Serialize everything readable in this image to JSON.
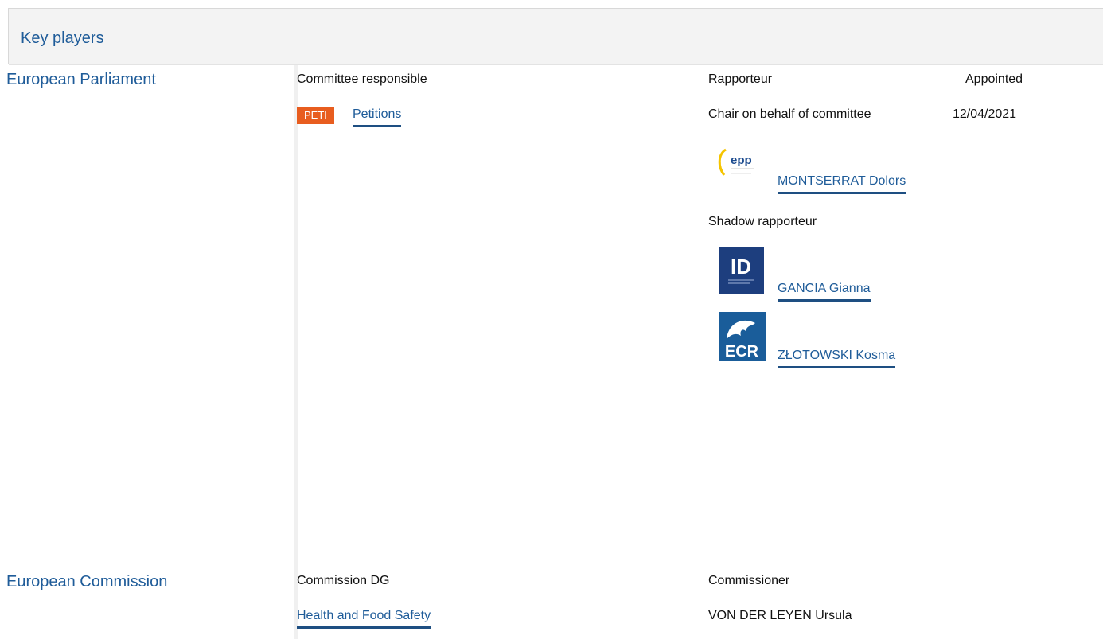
{
  "section": {
    "title": "Key players"
  },
  "parliament": {
    "institution": "European Parliament",
    "committee_label": "Committee responsible",
    "committee_tag": "PETI",
    "committee_name": "Petitions",
    "rapporteur_label": "Rapporteur",
    "appointed_label": "Appointed",
    "chair_label": "Chair on behalf of committee",
    "appointed_date": "12/04/2021",
    "rapporteur": {
      "group_logo": "epp-logo",
      "group_logo_text": "epp",
      "name": "MONTSERRAT Dolors"
    },
    "shadow_label": "Shadow rapporteur",
    "shadows": [
      {
        "group_logo": "id-logo",
        "group_logo_text": "ID",
        "name": "GANCIA Gianna"
      },
      {
        "group_logo": "ecr-logo",
        "group_logo_text": "ECR",
        "name": "ZŁOTOWSKI Kosma"
      }
    ]
  },
  "commission": {
    "institution": "European Commission",
    "dg_label": "Commission DG",
    "dg_name": "Health and Food Safety",
    "commissioner_label": "Commissioner",
    "commissioner_name": "VON DER LEYEN Ursula"
  },
  "colors": {
    "link": "#1f5c99",
    "link_underline": "#1e4f82",
    "tag_bg": "#e85d1f",
    "header_bg": "#f3f3f3",
    "id_blue": "#1d3e7e",
    "ecr_blue": "#1a5d9a",
    "epp_blue": "#1c4b8f",
    "epp_yellow": "#f5c400"
  }
}
